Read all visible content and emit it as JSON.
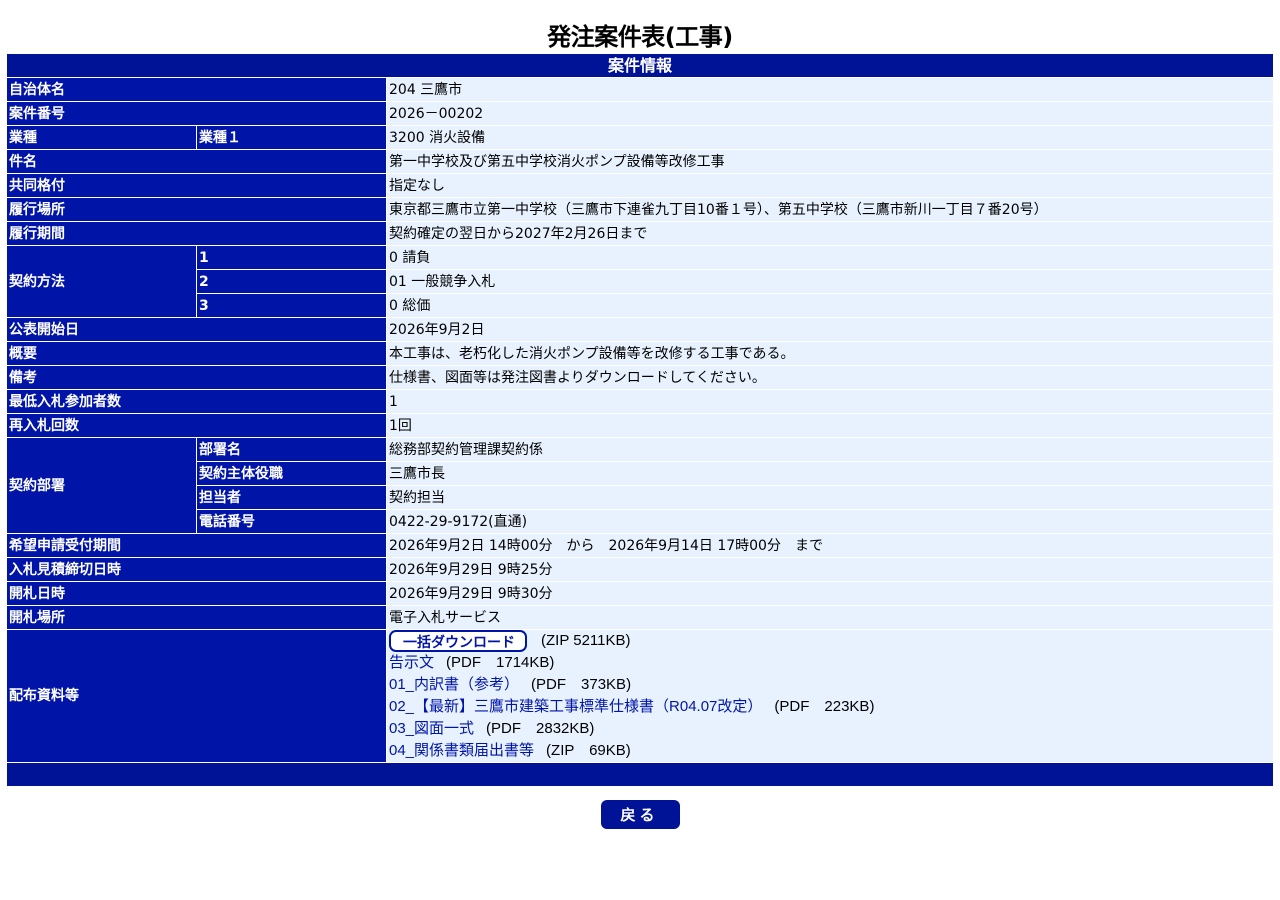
{
  "page": {
    "title": "発注案件表(工事)",
    "section_header": "案件情報"
  },
  "rows": {
    "municipality": {
      "label": "自治体名",
      "value": "204 三鷹市"
    },
    "case_number": {
      "label": "案件番号",
      "value": "2026－00202"
    },
    "industry": {
      "label": "業種",
      "sub_label": "業種１",
      "value": "3200 消火設備"
    },
    "subject": {
      "label": "件名",
      "value": "第一中学校及び第五中学校消火ポンプ設備等改修工事"
    },
    "joint_rating": {
      "label": "共同格付",
      "value": "指定なし"
    },
    "location": {
      "label": "履行場所",
      "value": "東京都三鷹市立第一中学校（三鷹市下連雀九丁目10番１号）、第五中学校（三鷹市新川一丁目７番20号）"
    },
    "period": {
      "label": "履行期間",
      "value": "契約確定の翌日から2027年2月26日まで"
    },
    "contract_method": {
      "label": "契約方法",
      "items": [
        {
          "sub_label": "1",
          "value": "0 請負"
        },
        {
          "sub_label": "2",
          "value": "01 一般競争入札"
        },
        {
          "sub_label": "3",
          "value": "0 総価"
        }
      ]
    },
    "publish_date": {
      "label": "公表開始日",
      "value": "2026年9月2日"
    },
    "summary": {
      "label": "概要",
      "value": "本工事は、老朽化した消火ポンプ設備等を改修する工事である。"
    },
    "remarks": {
      "label": "備考",
      "value": "仕様書、図面等は発注図書よりダウンロードしてください。"
    },
    "min_bidders": {
      "label": "最低入札参加者数",
      "value": "1"
    },
    "rebid_count": {
      "label": "再入札回数",
      "value": "1回"
    },
    "contract_dept": {
      "label": "契約部署",
      "items": [
        {
          "sub_label": "部署名",
          "value": "総務部契約管理課契約係"
        },
        {
          "sub_label": "契約主体役職",
          "value": "三鷹市長"
        },
        {
          "sub_label": "担当者",
          "value": "契約担当"
        },
        {
          "sub_label": "電話番号",
          "value": "0422-29-9172(直通)"
        }
      ]
    },
    "application_period": {
      "label": "希望申請受付期間",
      "value": "2026年9月2日 14時00分　から　2026年9月14日 17時00分　まで"
    },
    "bid_deadline": {
      "label": "入札見積締切日時",
      "value": "2026年9月29日 9時25分"
    },
    "opening_datetime": {
      "label": "開札日時",
      "value": "2026年9月29日 9時30分"
    },
    "opening_place": {
      "label": "開札場所",
      "value": "電子入札サービス"
    },
    "materials": {
      "label": "配布資料等",
      "bulk_download_label": "一括ダウンロード",
      "bulk_download_size": "(ZIP 5211KB)",
      "files": [
        {
          "name": "告示文",
          "meta": "(PDF　1714KB)"
        },
        {
          "name": "01_内訳書（参考）",
          "meta": "(PDF　373KB)"
        },
        {
          "name": "02_【最新】三鷹市建築工事標準仕様書（R04.07改定）",
          "meta": "(PDF　223KB)"
        },
        {
          "name": "03_図面一式",
          "meta": "(PDF　2832KB)"
        },
        {
          "name": "04_関係書類届出書等",
          "meta": "(ZIP　69KB)"
        }
      ]
    }
  },
  "back_button_label": "戻る",
  "colors": {
    "header_blue": "#001296",
    "label_blue": "#0014a8",
    "value_bg": "#e8f2ff",
    "link_blue": "#0014a8"
  }
}
